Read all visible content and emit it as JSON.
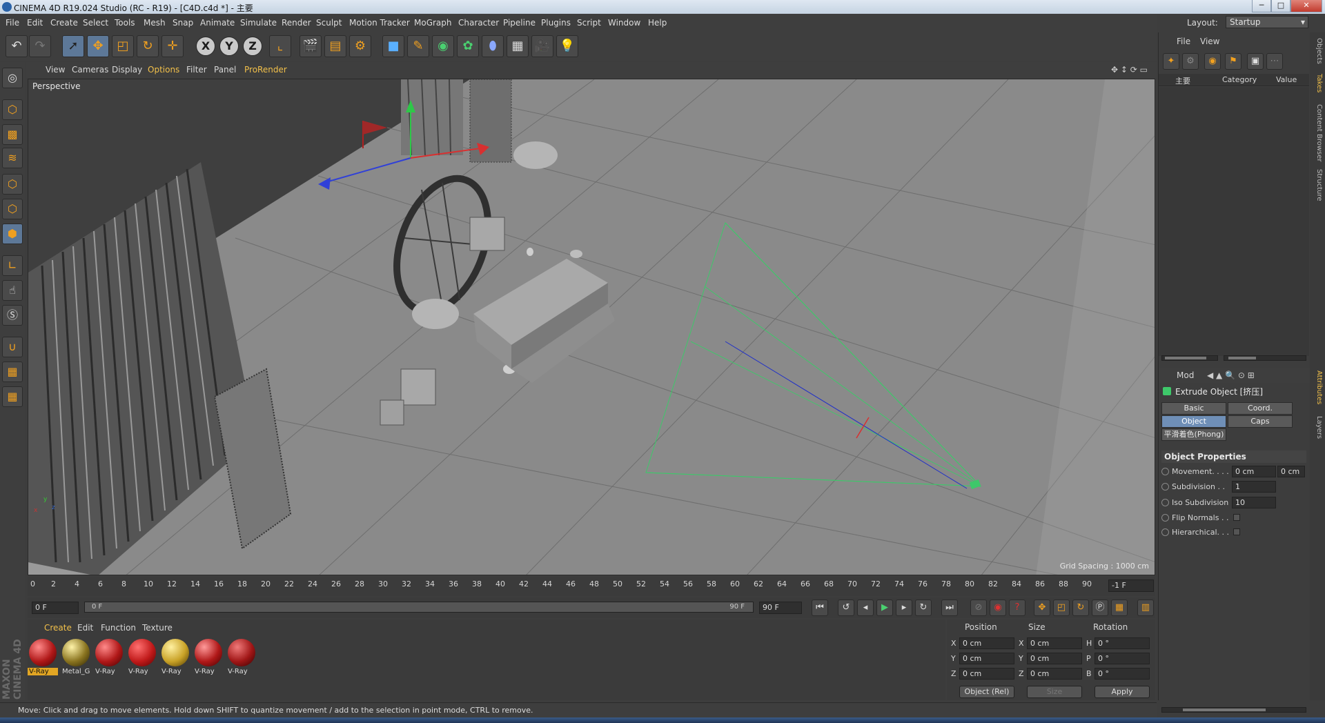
{
  "window": {
    "title": "CINEMA 4D R19.024 Studio (RC - R19) - [C4D.c4d *] - 主要",
    "minimize": "─",
    "maximize": "□",
    "close": "✕"
  },
  "menu": [
    "File",
    "Edit",
    "Create",
    "Select",
    "Tools",
    "Mesh",
    "Snap",
    "Animate",
    "Simulate",
    "Render",
    "Sculpt",
    "Motion Tracker",
    "MoGraph",
    "Character",
    "Pipeline",
    "Plugins",
    "Script",
    "Window",
    "Help"
  ],
  "layout": {
    "label": "Layout:",
    "value": "Startup"
  },
  "toolbar": {
    "icons": [
      "undo-icon",
      "redo-icon",
      "select-icon",
      "move-icon",
      "scale-icon",
      "rotate-icon",
      "live-select-icon",
      "x-axis-icon",
      "y-axis-icon",
      "z-axis-icon",
      "coordinate-system-icon",
      "render-view-icon",
      "render-picture-viewer-icon",
      "edit-render-settings-icon",
      "cube-icon",
      "pen-icon",
      "subdivision-icon",
      "cloner-icon",
      "deformer-icon",
      "floor-icon",
      "camera-icon",
      "light-icon"
    ],
    "x": "X",
    "y": "Y",
    "z": "Z"
  },
  "viewport": {
    "menu": [
      "View",
      "Cameras",
      "Display",
      "Options",
      "Filter",
      "Panel",
      "ProRender"
    ],
    "active_menu": "Options",
    "label": "Perspective",
    "grid_spacing": "Grid Spacing : 1000 cm",
    "axis_x": "x",
    "axis_y": "y",
    "axis_z": "z"
  },
  "timeline": {
    "ticks": [
      "0",
      "2",
      "4",
      "6",
      "8",
      "10",
      "12",
      "14",
      "16",
      "18",
      "20",
      "22",
      "24",
      "26",
      "28",
      "30",
      "32",
      "34",
      "36",
      "38",
      "40",
      "42",
      "44",
      "46",
      "48",
      "50",
      "52",
      "54",
      "56",
      "58",
      "60",
      "62",
      "64",
      "66",
      "68",
      "70",
      "72",
      "74",
      "76",
      "78",
      "80",
      "82",
      "84",
      "86",
      "88",
      "90"
    ],
    "end_frame": "-1 F",
    "current": "0 F",
    "scrub_start": "0 F",
    "scrub_end": "90 F",
    "max": "90 F"
  },
  "materials": {
    "menu": [
      "Create",
      "Edit",
      "Function",
      "Texture"
    ],
    "active_menu": "Create",
    "items": [
      {
        "label": "V-Ray",
        "color": "#b01818"
      },
      {
        "label": "Metal_G",
        "color": "#8a7420"
      },
      {
        "label": "V-Ray",
        "color": "#b01818"
      },
      {
        "label": "V-Ray",
        "color": "#b01818"
      },
      {
        "label": "V-Ray",
        "color": "#c9a227"
      },
      {
        "label": "V-Ray",
        "color": "#b01818"
      },
      {
        "label": "V-Ray",
        "color": "#a01616"
      }
    ]
  },
  "coords": {
    "headers": {
      "position": "Position",
      "size": "Size",
      "rotation": "Rotation"
    },
    "rows": [
      {
        "axis": "X",
        "pos": "0 cm",
        "saxis": "X",
        "size": "0 cm",
        "raxis": "H",
        "rot": "0 °"
      },
      {
        "axis": "Y",
        "pos": "0 cm",
        "saxis": "Y",
        "size": "0 cm",
        "raxis": "P",
        "rot": "0 °"
      },
      {
        "axis": "Z",
        "pos": "0 cm",
        "saxis": "Z",
        "size": "0 cm",
        "raxis": "B",
        "rot": "0 °"
      }
    ],
    "mode": "Object (Rel)",
    "size_mode": "Size",
    "apply": "Apply"
  },
  "status": "Move: Click and drag to move elements. Hold down SHIFT to quantize movement / add to the selection in point mode, CTRL to remove.",
  "objects_panel": {
    "menu": [
      "File",
      "View"
    ],
    "col_name": "主要",
    "col_category": "Category",
    "col_value": "Value"
  },
  "attributes": {
    "menu": "Mod",
    "title": "Extrude Object [挤压]",
    "tabs": [
      "Basic",
      "Coord.",
      "Object",
      "Caps",
      "平滑着色(Phong)"
    ],
    "active_tab": "Object",
    "section": "Object Properties",
    "props": [
      {
        "label": "Movement. . . .",
        "value": "0 cm",
        "extra": "0 cm"
      },
      {
        "label": "Subdivision . .",
        "value": "1"
      },
      {
        "label": "Iso Subdivision",
        "value": "10"
      },
      {
        "label": "Flip Normals . ."
      },
      {
        "label": "Hierarchical. . ."
      }
    ]
  },
  "side_tabs": [
    "Objects",
    "Takes",
    "Content Browser",
    "Structure",
    "Attributes",
    "Layers"
  ],
  "brand": "MAXON CINEMA 4D"
}
